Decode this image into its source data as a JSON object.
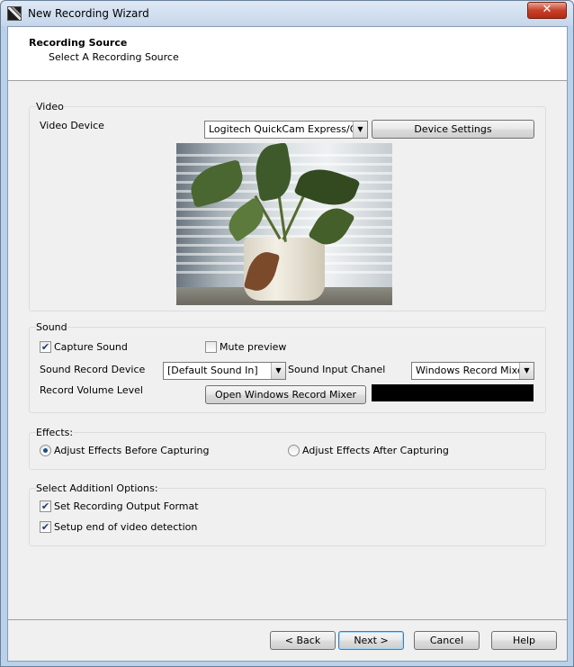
{
  "window": {
    "title": "New Recording Wizard",
    "close_symbol": "✕"
  },
  "header": {
    "title": "Recording Source",
    "subtitle": "Select A Recording Source"
  },
  "video": {
    "group_label": "Video",
    "device_label": "Video Device",
    "device_value": "Logitech QuickCam Express/Go",
    "settings_button": "Device Settings"
  },
  "sound": {
    "group_label": "Sound",
    "capture_label": "Capture Sound",
    "capture_checked": true,
    "mute_label": "Mute preview",
    "mute_checked": false,
    "record_device_label": "Sound Record Device",
    "record_device_value": "[Default Sound In]",
    "input_channel_label": "Sound Input Chanel",
    "input_channel_value": "Windows Record Mixer",
    "volume_label": "Record Volume Level",
    "mixer_button": "Open Windows Record Mixer"
  },
  "effects": {
    "group_label": "Effects:",
    "before_label": "Adjust Effects Before Capturing",
    "after_label": "Adjust Effects After Capturing",
    "selected": "before"
  },
  "options": {
    "group_label": "Select Additionl Options:",
    "output_format_label": "Set Recording Output Format",
    "output_format_checked": true,
    "end_detection_label": "Setup end of video detection",
    "end_detection_checked": true
  },
  "footer": {
    "back": "< Back",
    "next": "Next >",
    "cancel": "Cancel",
    "help": "Help"
  },
  "icons": {
    "dropdown": "chevron-down-icon",
    "check": "checkmark-icon"
  },
  "colors": {
    "accent": "#3c7fb1",
    "close": "#c7412a",
    "level_meter": "#000000"
  }
}
